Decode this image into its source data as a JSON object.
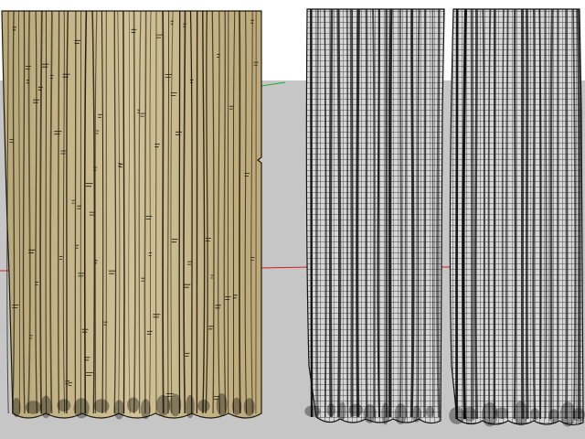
{
  "scene": {
    "description_free": true,
    "background": {
      "sky": "#ffffff",
      "ground": "#c6c6c6"
    },
    "axes": {
      "x_axis_color": "#d02020",
      "y_axis_color": "#22aa33"
    },
    "objects": [
      {
        "name": "textured-curtain",
        "style": "textured",
        "fabric_color": "#c8b98a",
        "line_color": "#1f1a10"
      },
      {
        "name": "wireframe-curtain-left",
        "style": "wireframe",
        "fabric_color": "#d4d4d4",
        "line_color": "#111111"
      },
      {
        "name": "wireframe-curtain-right",
        "style": "wireframe",
        "fabric_color": "#d4d4d4",
        "line_color": "#111111"
      }
    ]
  }
}
